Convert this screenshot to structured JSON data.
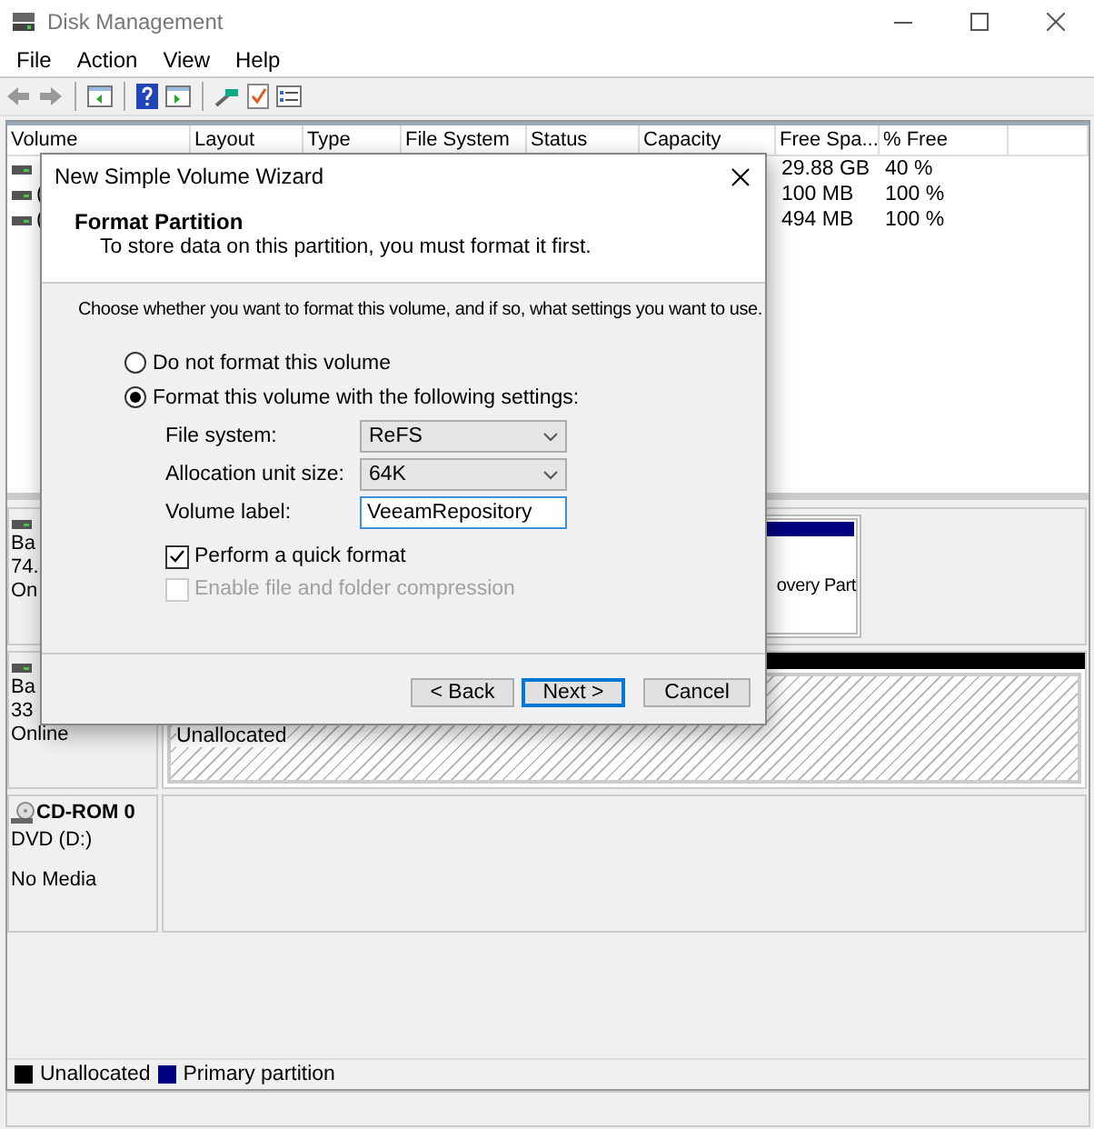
{
  "window": {
    "title": "Disk Management"
  },
  "menu": [
    "File",
    "Action",
    "View",
    "Help"
  ],
  "table": {
    "columns": [
      "Volume",
      "Layout",
      "Type",
      "File System",
      "Status",
      "Capacity",
      "Free Spa...",
      "% Free"
    ],
    "rows": [
      {
        "free_space": "29.88 GB",
        "percent_free": "40 %"
      },
      {
        "volume": "(",
        "free_space": "100 MB",
        "percent_free": "100 %"
      },
      {
        "volume": "(",
        "free_space": "494 MB",
        "percent_free": "100 %"
      }
    ]
  },
  "disks": [
    {
      "kind": "basic",
      "lines": [
        "Ba",
        "74.",
        "On"
      ],
      "partitions": [
        {
          "kind": "primary",
          "label": "overy Part"
        }
      ]
    },
    {
      "kind": "basic",
      "lines": [
        "Ba",
        "33",
        "Online"
      ],
      "partitions": [
        {
          "kind": "unallocated",
          "label": "Unallocated"
        }
      ]
    },
    {
      "kind": "cdrom",
      "name": "CD-ROM 0",
      "lines": [
        "DVD (D:)",
        "No Media"
      ]
    }
  ],
  "legend": [
    {
      "label": "Unallocated",
      "color": "#000000"
    },
    {
      "label": "Primary partition",
      "color": "#000080"
    }
  ],
  "dialog": {
    "title": "New Simple Volume Wizard",
    "heading": "Format Partition",
    "subheading": "To store data on this partition, you must format it first.",
    "prompt": "Choose whether you want to format this volume, and if so, what settings you want to use.",
    "options": [
      {
        "label": "Do not format this volume",
        "selected": false
      },
      {
        "label": "Format this volume with the following settings:",
        "selected": true
      }
    ],
    "fields": [
      {
        "kind": "dropdown",
        "label": "File system:",
        "value": "ReFS"
      },
      {
        "kind": "dropdown",
        "label": "Allocation unit size:",
        "value": "64K"
      },
      {
        "kind": "text",
        "label": "Volume label:",
        "value": "VeeamRepository"
      }
    ],
    "checkboxes": [
      {
        "label": "Perform a quick format",
        "checked": true,
        "disabled": false
      },
      {
        "label": "Enable file and folder compression",
        "checked": false,
        "disabled": true
      }
    ],
    "buttons": [
      {
        "label": "< Back",
        "default": false
      },
      {
        "label": "Next >",
        "default": true
      },
      {
        "label": "Cancel",
        "default": false
      }
    ]
  }
}
